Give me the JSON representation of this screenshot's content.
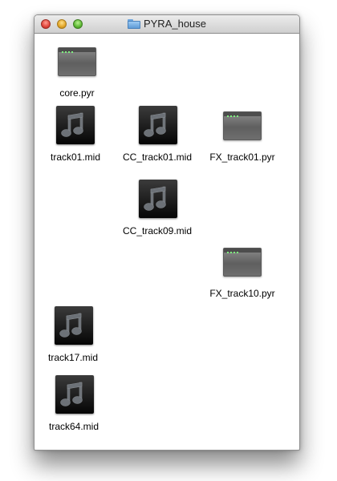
{
  "window": {
    "title": "PYRA_house",
    "title_icon": "folder-icon",
    "controls": [
      "close",
      "minimize",
      "zoom"
    ]
  },
  "files": [
    {
      "name": "core.pyr",
      "kind": "pyr",
      "icon": "pyr-file-icon"
    },
    {
      "name": "track01.mid",
      "kind": "midi",
      "icon": "midi-file-icon"
    },
    {
      "name": "CC_track01.mid",
      "kind": "midi",
      "icon": "midi-file-icon"
    },
    {
      "name": "FX_track01.pyr",
      "kind": "pyr",
      "icon": "pyr-file-icon"
    },
    {
      "name": "CC_track09.mid",
      "kind": "midi",
      "icon": "midi-file-icon"
    },
    {
      "name": "FX_track10.pyr",
      "kind": "pyr",
      "icon": "pyr-file-icon"
    },
    {
      "name": "track17.mid",
      "kind": "midi",
      "icon": "midi-file-icon"
    },
    {
      "name": "track64.mid",
      "kind": "midi",
      "icon": "midi-file-icon"
    }
  ],
  "colors": {
    "titlebar_top": "#ececec",
    "titlebar_bottom": "#cfcfcf",
    "close": "#e0443a",
    "minimize": "#e2a526",
    "zoom": "#5cb832",
    "folder": "#6aa5df",
    "midi_icon_bg": "#050505",
    "pyr_icon_bg": "#6e6e6e",
    "pyr_indicator": "#7ef07e"
  }
}
